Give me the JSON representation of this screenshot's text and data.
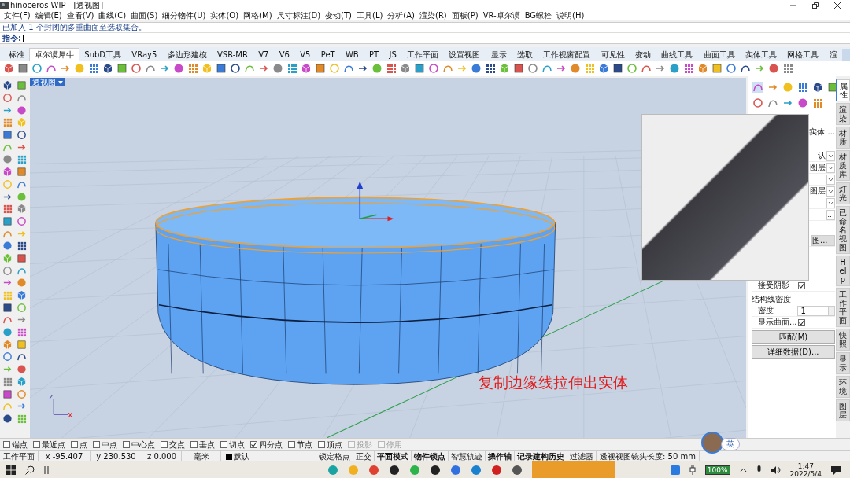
{
  "window": {
    "title": "hinoceros WIP - [透视图]"
  },
  "menu": [
    "文件(F)",
    "编辑(E)",
    "查看(V)",
    "曲线(C)",
    "曲面(S)",
    "细分物件(U)",
    "实体(O)",
    "网格(M)",
    "尺寸标注(D)",
    "变动(T)",
    "工具(L)",
    "分析(A)",
    "渲染(R)",
    "面板(P)",
    "VR-卓尔谟",
    "BG螺栓",
    "说明(H)"
  ],
  "command": {
    "history": "已加入 1 个封闭的多重曲面至选取集合。",
    "prompt": "指令:"
  },
  "tabs": [
    {
      "label": "标准",
      "selected": false
    },
    {
      "label": "卓尔谟犀牛",
      "selected": true
    },
    {
      "label": "SubD工具",
      "selected": false
    },
    {
      "label": "VRay5",
      "selected": false
    },
    {
      "label": "多边形建模",
      "selected": false
    },
    {
      "label": "VSR-MR",
      "selected": false
    },
    {
      "label": "V7",
      "selected": false
    },
    {
      "label": "V6",
      "selected": false
    },
    {
      "label": "V5",
      "selected": false
    },
    {
      "label": "PeT",
      "selected": false
    },
    {
      "label": "WB",
      "selected": false
    },
    {
      "label": "PT",
      "selected": false
    },
    {
      "label": "JS",
      "selected": false
    },
    {
      "label": "工作平面",
      "selected": false
    },
    {
      "label": "设置视图",
      "selected": false
    },
    {
      "label": "显示",
      "selected": false
    },
    {
      "label": "选取",
      "selected": false
    },
    {
      "label": "工作视窗配置",
      "selected": false
    },
    {
      "label": "可见性",
      "selected": false
    },
    {
      "label": "变动",
      "selected": false
    },
    {
      "label": "曲线工具",
      "selected": false
    },
    {
      "label": "曲面工具",
      "selected": false
    },
    {
      "label": "实体工具",
      "selected": false
    },
    {
      "label": "网格工具",
      "selected": false
    },
    {
      "label": "渲",
      "selected": false
    }
  ],
  "viewport": {
    "label": "透视图",
    "caption": "复制边缘线拉伸出实体",
    "axes": [
      "z",
      "x"
    ]
  },
  "properties": {
    "rows": [
      {
        "kind": "text",
        "text": "实体 ..."
      },
      {
        "kind": "dropdown",
        "text": "认"
      },
      {
        "kind": "dropdown",
        "text": "图层"
      },
      {
        "kind": "dropdown"
      },
      {
        "kind": "dropdown",
        "text": "图层"
      },
      {
        "kind": "dropdown"
      },
      {
        "kind": "button",
        "text": "..."
      },
      {
        "kind": "wide",
        "text": "图..."
      }
    ],
    "shadow": {
      "label": "接受阴影",
      "checked": true
    },
    "isocurve": {
      "title": "结构线密度",
      "density_label": "密度",
      "density": "1",
      "show_label": "显示曲面...",
      "show_checked": true
    },
    "buttons": [
      "匹配(M)",
      "详细数据(D)..."
    ]
  },
  "side_tabs": [
    {
      "label": "属性",
      "selected": true
    },
    {
      "label": "渲染",
      "selected": false
    },
    {
      "label": "材质",
      "selected": false
    },
    {
      "label": "材质库",
      "selected": false
    },
    {
      "label": "灯光",
      "selected": false
    },
    {
      "label": "已命名视图",
      "selected": false
    },
    {
      "label": "Help",
      "selected": false
    },
    {
      "label": "工作平面",
      "selected": false
    },
    {
      "label": "快照",
      "selected": false
    },
    {
      "label": "显示",
      "selected": false
    },
    {
      "label": "环境",
      "selected": false
    },
    {
      "label": "图层",
      "selected": false
    }
  ],
  "osnaps": [
    {
      "label": "端点",
      "checked": false,
      "disabled": false
    },
    {
      "label": "最近点",
      "checked": false,
      "disabled": false
    },
    {
      "label": "点",
      "checked": false,
      "disabled": false
    },
    {
      "label": "中点",
      "checked": false,
      "disabled": false
    },
    {
      "label": "中心点",
      "checked": false,
      "disabled": false
    },
    {
      "label": "交点",
      "checked": false,
      "disabled": false
    },
    {
      "label": "垂点",
      "checked": false,
      "disabled": false
    },
    {
      "label": "切点",
      "checked": false,
      "disabled": false
    },
    {
      "label": "四分点",
      "checked": true,
      "disabled": false
    },
    {
      "label": "节点",
      "checked": false,
      "disabled": false
    },
    {
      "label": "顶点",
      "checked": false,
      "disabled": false
    },
    {
      "label": "投影",
      "checked": false,
      "disabled": true
    },
    {
      "label": "停用",
      "checked": false,
      "disabled": true
    }
  ],
  "status": {
    "cplane": "工作平面",
    "x": "x -95.407",
    "y": "y 230.530",
    "z": "z 0.000",
    "units": "毫米",
    "layer": "默认",
    "toggles": [
      {
        "label": "锁定格点",
        "on": false
      },
      {
        "label": "正交",
        "on": false
      },
      {
        "label": "平面模式",
        "on": true
      },
      {
        "label": "物件锁点",
        "on": true
      },
      {
        "label": "智慧轨迹",
        "on": false
      },
      {
        "label": "操作轴",
        "on": true
      },
      {
        "label": "记录建构历史",
        "on": true
      },
      {
        "label": "过滤器",
        "on": false
      }
    ],
    "message": "透视视图镜头长度: 50 mm"
  },
  "ime": "英",
  "taskbar": {
    "battery": "100%",
    "time": "1:47",
    "date": "2022/5/4"
  }
}
